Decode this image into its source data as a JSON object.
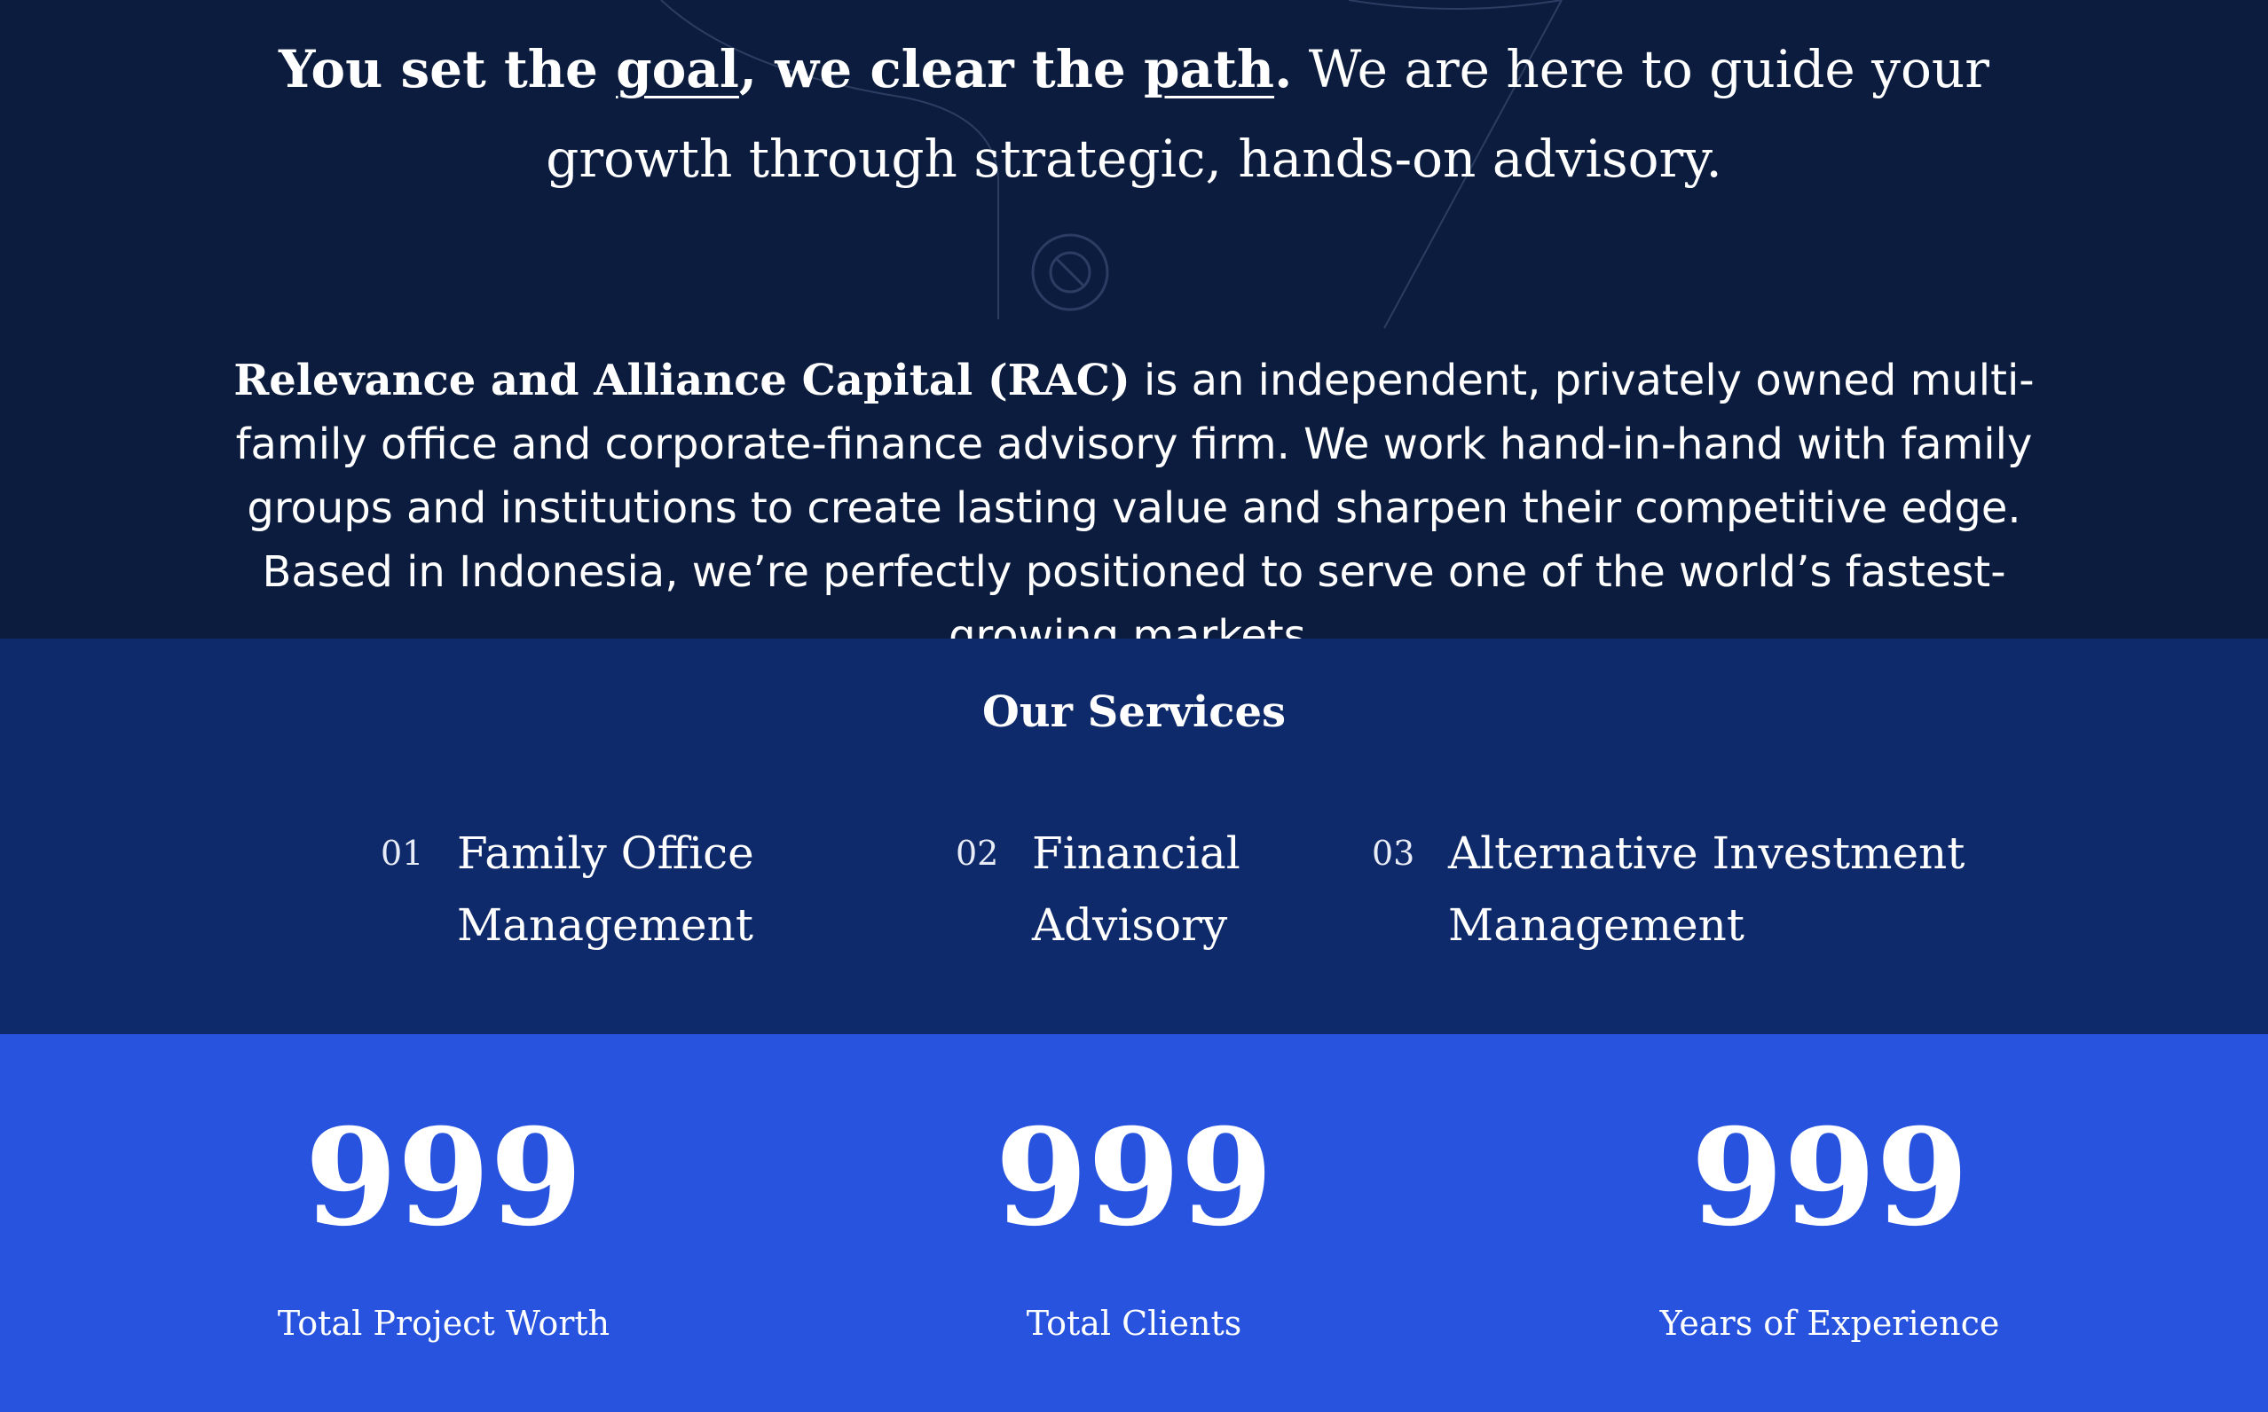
{
  "hero": {
    "tagline_part1": "You set the ",
    "tagline_goal": "goal",
    "tagline_part2": ", we clear the ",
    "tagline_path": "path",
    "tagline_period": ".",
    "tagline_part3": " We are here to guide your",
    "tagline_line2": "growth through strategic, hands-on advisory.",
    "about_brand": "Relevance and Alliance Capital (RAC)",
    "about_text": " is an independent, privately owned multi-family office and corporate-finance advisory firm. We work hand-in-hand with family groups and institutions to create lasting value and sharpen their competitive edge. Based in Indonesia, we’re perfectly positioned to serve one of the world’s fastest-growing markets."
  },
  "services": {
    "title": "Our Services",
    "items": [
      {
        "number": "01",
        "line1": "Family Office",
        "line2": "Management"
      },
      {
        "number": "02",
        "line1": "Financial",
        "line2": "Advisory"
      },
      {
        "number": "03",
        "line1": "Alternative Investment",
        "line2": "Management"
      }
    ]
  },
  "stats": [
    {
      "value": "999",
      "label": "Total Project Worth"
    },
    {
      "value": "999",
      "label": "Total Clients"
    },
    {
      "value": "999",
      "label": "Years of Experience"
    }
  ],
  "colors": {
    "hero_bg": "#0c1c3e",
    "services_bg": "#0f2a6b",
    "stats_bg": "#2753de",
    "text": "#ffffff"
  },
  "icons": {
    "decor": "blocked-circle-icon"
  }
}
